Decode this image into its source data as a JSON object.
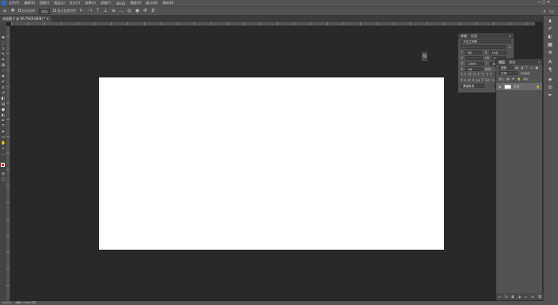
{
  "menu": {
    "items": [
      "文件(F)",
      "编辑(E)",
      "图像(I)",
      "图层(L)",
      "文字(Y)",
      "选择(S)",
      "滤镜(T)",
      "3D(D)",
      "视图(V)",
      "窗口(W)",
      "帮助(H)"
    ]
  },
  "options": {
    "auto_select_label": "自动选择:",
    "auto_select_value": "图层",
    "show_transform_label": "显示变换控件"
  },
  "document_tab": {
    "title": "未标题-1 @ 66.7%(RGB/8) *",
    "close": "×"
  },
  "character_panel": {
    "tabs": [
      "字符",
      "段落"
    ],
    "font_family": "方正兰亭黑",
    "font_style": "-",
    "size": "9点",
    "leading": "12点",
    "tracking": "0",
    "vertical_scale": "100%",
    "horizontal_scale": "100%",
    "baseline": "0点",
    "color_label": "颜色:",
    "language": "美国英语",
    "antialias": "aa 锐利"
  },
  "layers_panel": {
    "tabs": [
      "图层",
      "通道"
    ],
    "kind_filter": "类型",
    "blend_mode": "正常",
    "opacity_label": "不透明度:",
    "lock_label": "锁定:",
    "fill_label": "填充:",
    "layer_name": "背景"
  },
  "status": {
    "zoom": "66.67%",
    "doc_info": "文档:1.37M/0 字节"
  },
  "colors": {
    "canvas": "#ffffff",
    "app_bg": "#282828",
    "panel_bg": "#535353",
    "accent_red": "#d3201f"
  }
}
